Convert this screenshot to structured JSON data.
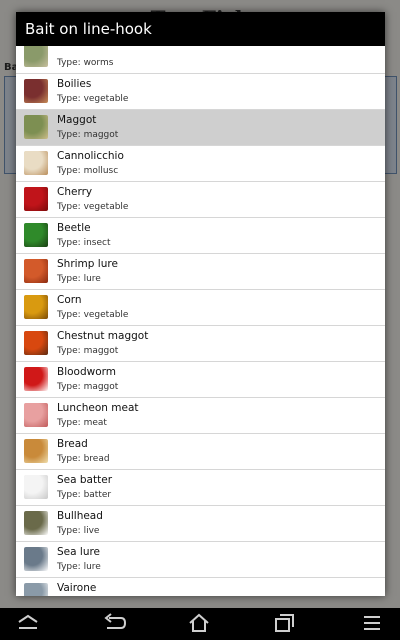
{
  "background": {
    "app_title": "TrueFish",
    "subtitle": "",
    "side_label": "Ba"
  },
  "dialog": {
    "title": "Bait on line-hook"
  },
  "baits": [
    {
      "name": "",
      "type": "Type: worms",
      "icon": "worms-thumb",
      "colors": [
        "#8a9a6a",
        "#c9c0a0"
      ]
    },
    {
      "name": "Boilies",
      "type": "Type: vegetable",
      "icon": "boilies-thumb",
      "colors": [
        "#7a2f2f",
        "#c98f5a"
      ]
    },
    {
      "name": "Maggot",
      "type": "Type: maggot",
      "icon": "maggot-thumb",
      "colors": [
        "#7d8f52",
        "#cdbd8b"
      ],
      "selected": true
    },
    {
      "name": "Cannolicchio",
      "type": "Type: mollusc",
      "icon": "cannolicchio-thumb",
      "colors": [
        "#e9dcc4",
        "#b98d5a"
      ]
    },
    {
      "name": "Cherry",
      "type": "Type: vegetable",
      "icon": "cherry-thumb",
      "colors": [
        "#c0141a",
        "#7a0a0a"
      ]
    },
    {
      "name": "Beetle",
      "type": "Type: insect",
      "icon": "beetle-thumb",
      "colors": [
        "#2f8a2a",
        "#1a3d12"
      ]
    },
    {
      "name": "Shrimp lure",
      "type": "Type: lure",
      "icon": "shrimp-lure-thumb",
      "colors": [
        "#d35a2a",
        "#8a2a10"
      ]
    },
    {
      "name": "Corn",
      "type": "Type: vegetable",
      "icon": "corn-thumb",
      "colors": [
        "#d99a10",
        "#7a4a08"
      ]
    },
    {
      "name": "Chestnut maggot",
      "type": "Type: maggot",
      "icon": "chestnut-maggot-thumb",
      "colors": [
        "#d8480f",
        "#5a2a10"
      ]
    },
    {
      "name": "Bloodworm",
      "type": "Type: maggot",
      "icon": "bloodworm-thumb",
      "colors": [
        "#d01818",
        "#ffffff"
      ]
    },
    {
      "name": "Luncheon meat",
      "type": "Type: meat",
      "icon": "luncheon-meat-thumb",
      "colors": [
        "#e8a0a0",
        "#c05a5a"
      ]
    },
    {
      "name": "Bread",
      "type": "Type: bread",
      "icon": "bread-thumb",
      "colors": [
        "#c98a3a",
        "#f0e0b0"
      ]
    },
    {
      "name": "Sea batter",
      "type": "Type: batter",
      "icon": "sea-batter-thumb",
      "colors": [
        "#f4f4f4",
        "#c8c8c8"
      ]
    },
    {
      "name": "Bullhead",
      "type": "Type: live",
      "icon": "bullhead-thumb",
      "colors": [
        "#6a6a4a",
        "#ffffff"
      ]
    },
    {
      "name": "Sea lure",
      "type": "Type: lure",
      "icon": "sea-lure-thumb",
      "colors": [
        "#6a7a8a",
        "#ffffff"
      ]
    },
    {
      "name": "Vairone",
      "type": "",
      "icon": "vairone-thumb",
      "colors": [
        "#8a9aa8",
        "#ffffff"
      ]
    }
  ],
  "navbar": {
    "buttons": [
      {
        "name": "nav-expand-icon"
      },
      {
        "name": "nav-back-icon"
      },
      {
        "name": "nav-home-icon"
      },
      {
        "name": "nav-recent-apps-icon"
      },
      {
        "name": "nav-menu-icon"
      }
    ]
  }
}
